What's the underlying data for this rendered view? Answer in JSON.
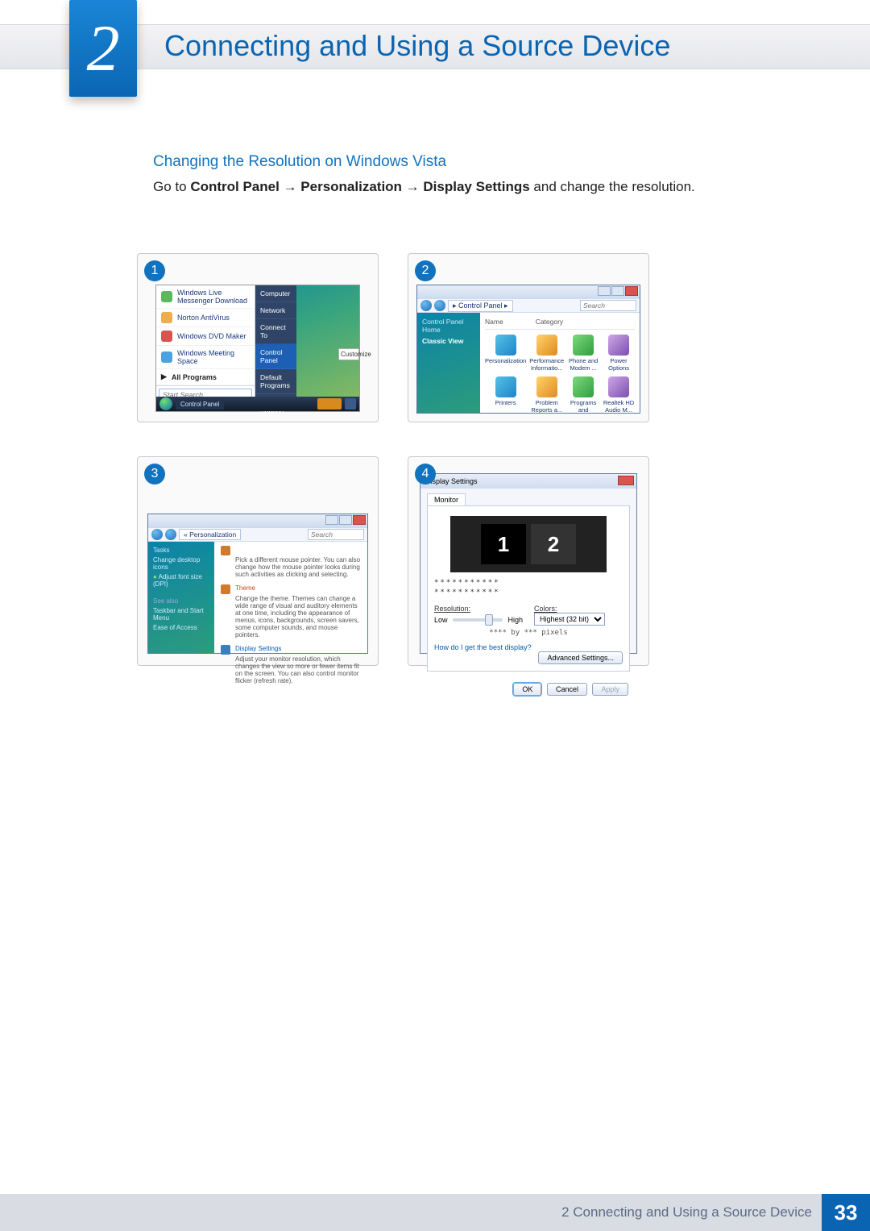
{
  "chapter": {
    "number": "2",
    "title": "Connecting and Using a Source Device"
  },
  "section": {
    "subtitle": "Changing the Resolution on Windows Vista",
    "instruction_pre": "Go to ",
    "bold1": "Control Panel",
    "arrow": " → ",
    "bold2": "Personalization",
    "bold3": "Display Settings",
    "instruction_post": " and change the resolution."
  },
  "badges": [
    "1",
    "2",
    "3",
    "4"
  ],
  "shot1": {
    "left": [
      "Windows Live Messenger Download",
      "Norton AntiVirus",
      "Windows DVD Maker",
      "Windows Meeting Space",
      "All Programs"
    ],
    "search_placeholder": "Start Search",
    "right": [
      "Computer",
      "Network",
      "Connect To",
      "Control Panel",
      "Default Programs",
      "Help and Support"
    ],
    "right_highlight": "Control Panel",
    "customize": "Customize",
    "taskbar": "Control Panel"
  },
  "shot2": {
    "breadcrumb": "▸ Control Panel ▸",
    "search_placeholder": "Search",
    "side": {
      "home": "Control Panel Home",
      "classic": "Classic View"
    },
    "cols": {
      "name": "Name",
      "category": "Category"
    },
    "items": [
      "Personalization",
      "Performance Informatio...",
      "Phone and Modem ...",
      "Power Options",
      "Printers",
      "Problem Reports a...",
      "Programs and Features",
      "Realtek HD Audio M..."
    ]
  },
  "shot3": {
    "breadcrumb": "« Personalization",
    "search_placeholder": "Search",
    "side": {
      "tasks": "Tasks",
      "link1": "Change desktop icons",
      "link2": "Adjust font size (DPI)",
      "seealso": "See also",
      "link3": "Taskbar and Start Menu",
      "link4": "Ease of Access"
    },
    "items": [
      {
        "title": "",
        "body": "Pick a different mouse pointer. You can also change how the mouse pointer looks during such activities as clicking and selecting."
      },
      {
        "title": "Theme",
        "body": "Change the theme. Themes can change a wide range of visual and auditory elements at one time, including the appearance of menus, icons, backgrounds, screen savers, some computer sounds, and mouse pointers."
      },
      {
        "title": "Display Settings",
        "body": "Adjust your monitor resolution, which changes the view so more or fewer items fit on the screen. You can also control monitor flicker (refresh rate)."
      }
    ]
  },
  "shot4": {
    "title": "Display Settings",
    "tab": "Monitor",
    "asterisks": "***********",
    "res_label": "Resolution:",
    "low": "Low",
    "high": "High",
    "pixels": "**** by *** pixels",
    "colors_label": "Colors:",
    "colors_value": "Highest (32 bit)",
    "help_link": "How do I get the best display?",
    "adv": "Advanced Settings...",
    "ok": "OK",
    "cancel": "Cancel",
    "apply": "Apply",
    "m1": "1",
    "m2": "2"
  },
  "footer": {
    "text": "2 Connecting and Using a Source Device",
    "page": "33"
  }
}
